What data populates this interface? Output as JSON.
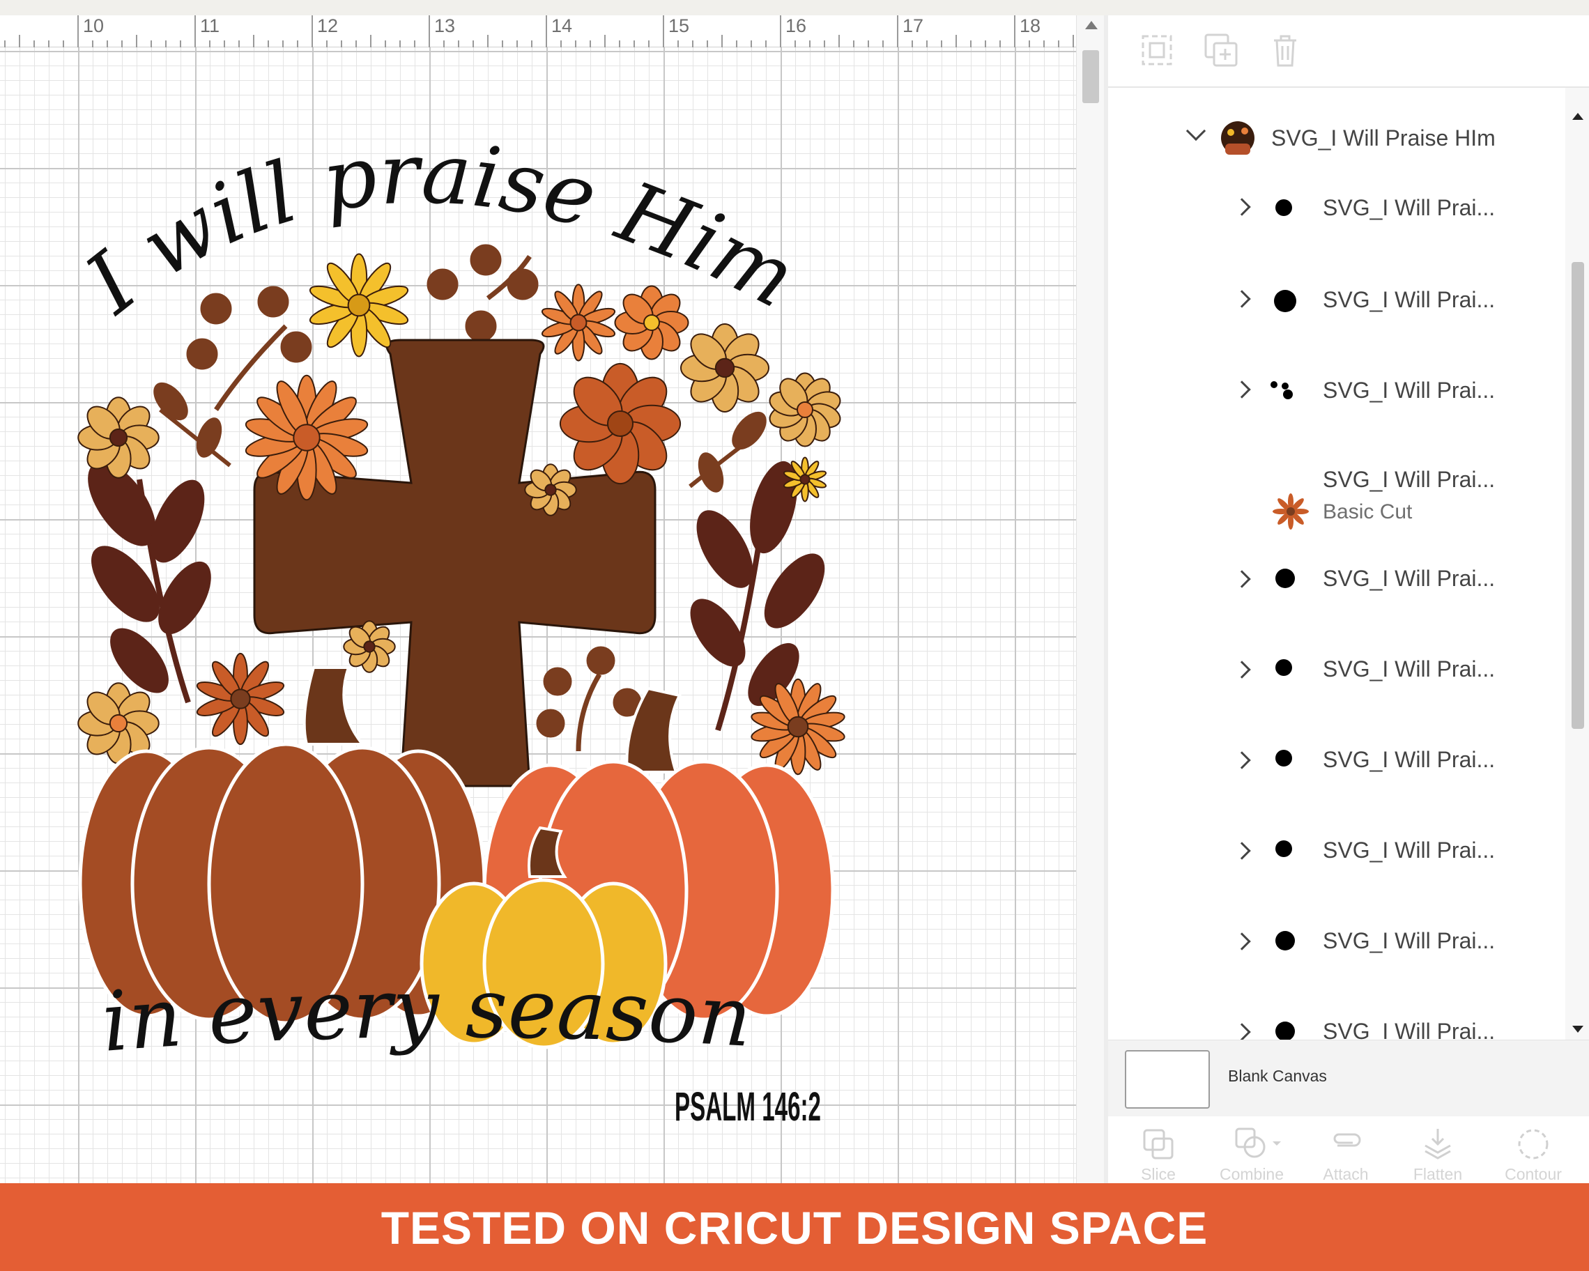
{
  "ruler": {
    "ticks": [
      "10",
      "11",
      "12",
      "13",
      "14",
      "15",
      "16",
      "17",
      "18"
    ]
  },
  "artwork": {
    "title_line1": "I will praise Him",
    "title_line2": "in every season",
    "verse": "PSALM 146:2",
    "colors": {
      "cross": "#6b361a",
      "pumpkin_left": "#a44c24",
      "pumpkin_right": "#e6673d",
      "pumpkin_small": "#f0b82a",
      "stem": "#6b361a",
      "leaf_dark": "#5c2418",
      "leaf_brown": "#7a3d1f",
      "flower_orange": "#e9803b",
      "flower_yellow": "#f4c02c",
      "flower_tan": "#e7b05a",
      "flower_rust": "#c95c28",
      "ink": "#111111"
    }
  },
  "toolbar": {
    "icons": [
      "group-select-icon",
      "duplicate-icon",
      "delete-icon"
    ]
  },
  "layers": {
    "group": {
      "name": "SVG_I Will Praise HIm",
      "expanded": true
    },
    "items": [
      {
        "name": "SVG_I Will Prai...",
        "expandable": true,
        "sub": ""
      },
      {
        "name": "SVG_I Will Prai...",
        "expandable": true,
        "sub": ""
      },
      {
        "name": "SVG_I Will Prai...",
        "expandable": true,
        "sub": ""
      },
      {
        "name": "SVG_I Will Prai...",
        "expandable": false,
        "sub": "Basic Cut"
      },
      {
        "name": "SVG_I Will Prai...",
        "expandable": true,
        "sub": ""
      },
      {
        "name": "SVG_I Will Prai...",
        "expandable": true,
        "sub": ""
      },
      {
        "name": "SVG_I Will Prai...",
        "expandable": true,
        "sub": ""
      },
      {
        "name": "SVG_I Will Prai...",
        "expandable": true,
        "sub": ""
      },
      {
        "name": "SVG_I Will Prai...",
        "expandable": true,
        "sub": ""
      },
      {
        "name": "SVG_I Will Prai...",
        "expandable": true,
        "sub": ""
      }
    ]
  },
  "blank_canvas": {
    "label": "Blank Canvas"
  },
  "bottom_tools": [
    {
      "label": "Slice",
      "icon": "slice-icon"
    },
    {
      "label": "Combine",
      "icon": "combine-icon"
    },
    {
      "label": "Attach",
      "icon": "attach-icon"
    },
    {
      "label": "Flatten",
      "icon": "flatten-icon"
    },
    {
      "label": "Contour",
      "icon": "contour-icon"
    }
  ],
  "banner": {
    "text": "TESTED ON CRICUT DESIGN SPACE",
    "color": "#e45e34"
  }
}
